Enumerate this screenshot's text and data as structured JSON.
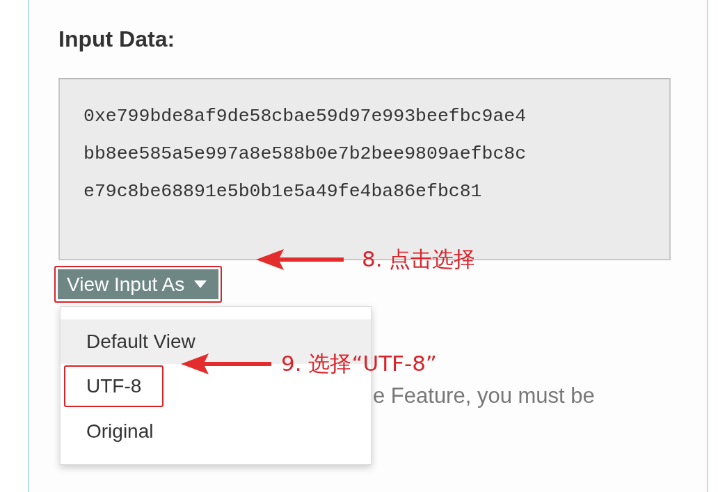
{
  "section": {
    "title": "Input Data:",
    "input_lines": [
      "0xe799bde8af9de58cbae59d97e993beefbc9ae4",
      "bb8ee585a5e997a8e588b0e7b2bee9809aefbc8c",
      "e79c8be68891e5b0b1e5a49fe4ba86efbc81"
    ],
    "view_button": {
      "label": "View Input As",
      "expanded": true,
      "outlined": true
    },
    "dropdown_items": [
      {
        "label": "Default View",
        "hovered": true,
        "outlined": false
      },
      {
        "label": "UTF-8",
        "hovered": false,
        "outlined": true
      },
      {
        "label": "Original",
        "hovered": false,
        "outlined": false
      }
    ],
    "note_text": "e Feature, you must be"
  },
  "annotations": [
    {
      "label": "8. 点击选择"
    },
    {
      "label": "9. 选择“UTF-8”"
    }
  ]
}
